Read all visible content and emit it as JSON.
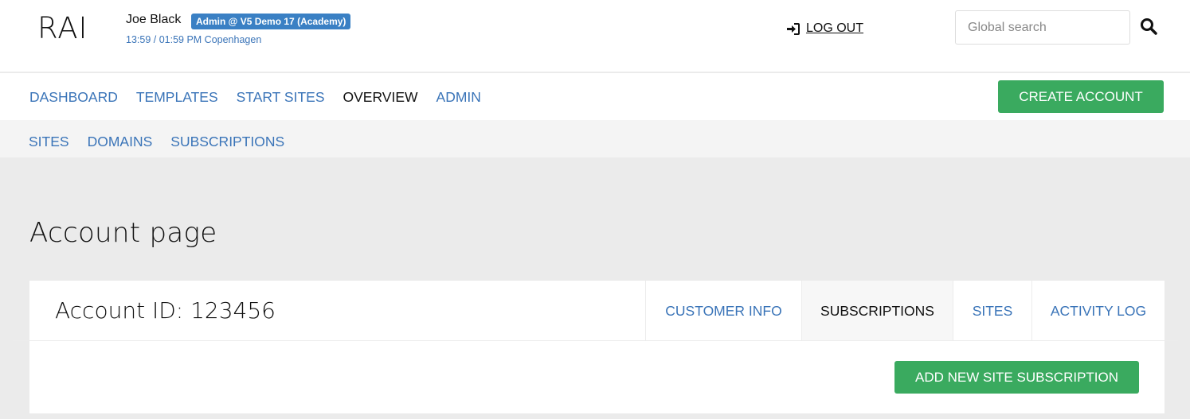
{
  "header": {
    "logo": "RAI",
    "user_name": "Joe Black",
    "role_badge": "Admin @ V5 Demo 17 (Academy)",
    "clock": "13:59 / 01:59 PM Copenhagen",
    "logout_label": "LOG OUT",
    "logout_icon": "sign-out-icon",
    "search_placeholder": "Global search",
    "search_value": "",
    "search_icon": "magnifier-icon"
  },
  "main_nav": {
    "items": [
      {
        "label": "DASHBOARD",
        "active": false
      },
      {
        "label": "TEMPLATES",
        "active": false
      },
      {
        "label": "START SITES",
        "active": false
      },
      {
        "label": "OVERVIEW",
        "active": true
      },
      {
        "label": "ADMIN",
        "active": false
      }
    ],
    "create_account_label": "CREATE ACCOUNT"
  },
  "sub_nav": {
    "items": [
      {
        "label": "SITES"
      },
      {
        "label": "DOMAINS"
      },
      {
        "label": "SUBSCRIPTIONS"
      }
    ]
  },
  "page": {
    "title": "Account page",
    "account_id": "Account ID: 123456",
    "tabs": [
      {
        "label": "CUSTOMER INFO",
        "active": false
      },
      {
        "label": "SUBSCRIPTIONS",
        "active": true
      },
      {
        "label": "SITES",
        "active": false
      },
      {
        "label": "ACTIVITY LOG",
        "active": false
      }
    ],
    "add_button_label": "ADD NEW SITE SUBSCRIPTION"
  },
  "colors": {
    "link_blue": "#3a74b8",
    "badge_blue": "#3a80c4",
    "button_green": "#3aaa5f",
    "page_bg": "#ebebeb"
  }
}
